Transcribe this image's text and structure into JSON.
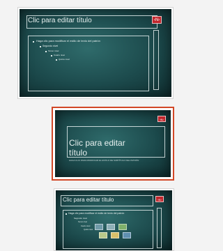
{
  "thumbnails": [
    {
      "layout": "title-and-content",
      "selected": false,
      "title": "Clic para editar título",
      "number_badge": "‹N›",
      "bullets": [
        "Haga clic para modificar el estilo de texto del patrón",
        "Segundo nivel",
        "Tercer nivel",
        "Cuarto nivel",
        "Quinto nivel"
      ]
    },
    {
      "layout": "title-slide",
      "selected": true,
      "title": "Clic para editar título",
      "subtitle": "HAGA CLIC PARA MODIFICAR EL ESTILO DE SUBTÍTULO DEL PATRÓN",
      "number_badge": "‹N›"
    },
    {
      "layout": "title-and-content",
      "selected": false,
      "title": "Clic para editar título",
      "number_badge": "‹N›",
      "bullets": [
        "Haga clic para modificar el estilo de texto del patrón",
        "Segundo nivel",
        "Tercer nivel",
        "Cuarto nivel",
        "Quinto nivel"
      ]
    }
  ],
  "colors": {
    "selection_border": "#d24726",
    "slide_background": "#1c4a4c",
    "number_badge": "#c0262c"
  }
}
